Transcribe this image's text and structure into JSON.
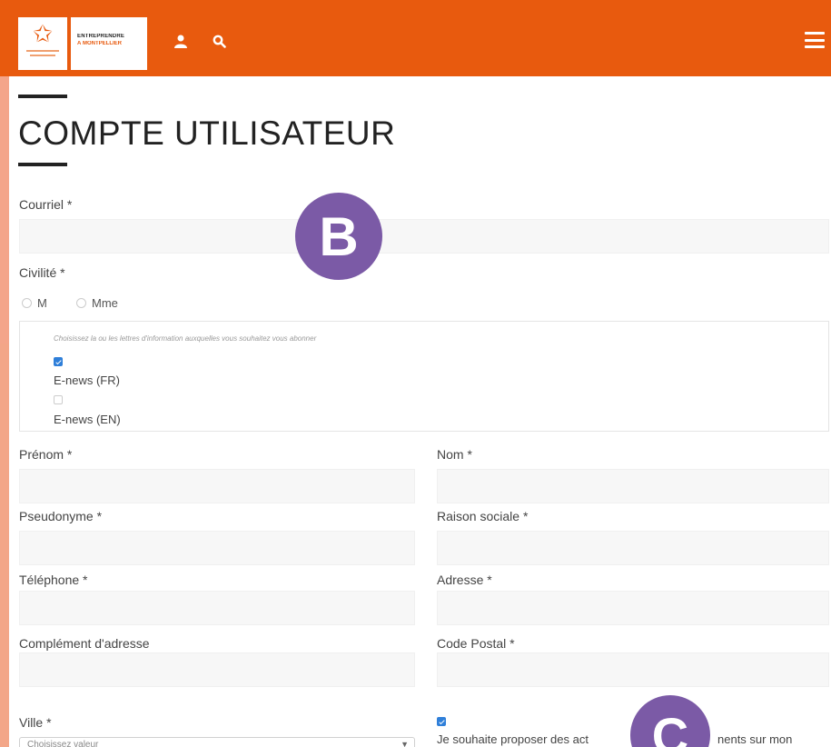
{
  "header": {
    "logo_line1": "ENTREPRENDRE",
    "logo_line2": "À MONTPELLIER",
    "user_icon": "user-icon",
    "search_icon": "search-icon",
    "menu_icon": "hamburger-menu-icon",
    "accent_color": "#e85a0e"
  },
  "page": {
    "title": "COMPTE UTILISATEUR"
  },
  "form": {
    "email_label": "Courriel *",
    "civility_label": "Civilité *",
    "civility_options": [
      "M",
      "Mme"
    ],
    "newsletter_hint": "Choisissez la ou les lettres d'information auxquelles vous souhaitez vous abonner",
    "newsletters": [
      {
        "label": "E-news (FR)",
        "checked": true
      },
      {
        "label": "E-news (EN)",
        "checked": false
      }
    ],
    "firstname_label": "Prénom *",
    "lastname_label": "Nom *",
    "nickname_label": "Pseudonyme *",
    "company_label": "Raison sociale *",
    "phone_label": "Téléphone *",
    "address_label": "Adresse *",
    "address2_label": "Complément d'adresse",
    "postal_label": "Code Postal *",
    "city_label": "Ville *",
    "city_select_value": "Choisissez valeur",
    "events_checkbox_label_start": "Je souhaite proposer des act",
    "events_checkbox_label_end": "nents sur mon",
    "events_checked": true
  },
  "badges": {
    "b": "B",
    "c": "C",
    "color": "#7b5aa6"
  }
}
